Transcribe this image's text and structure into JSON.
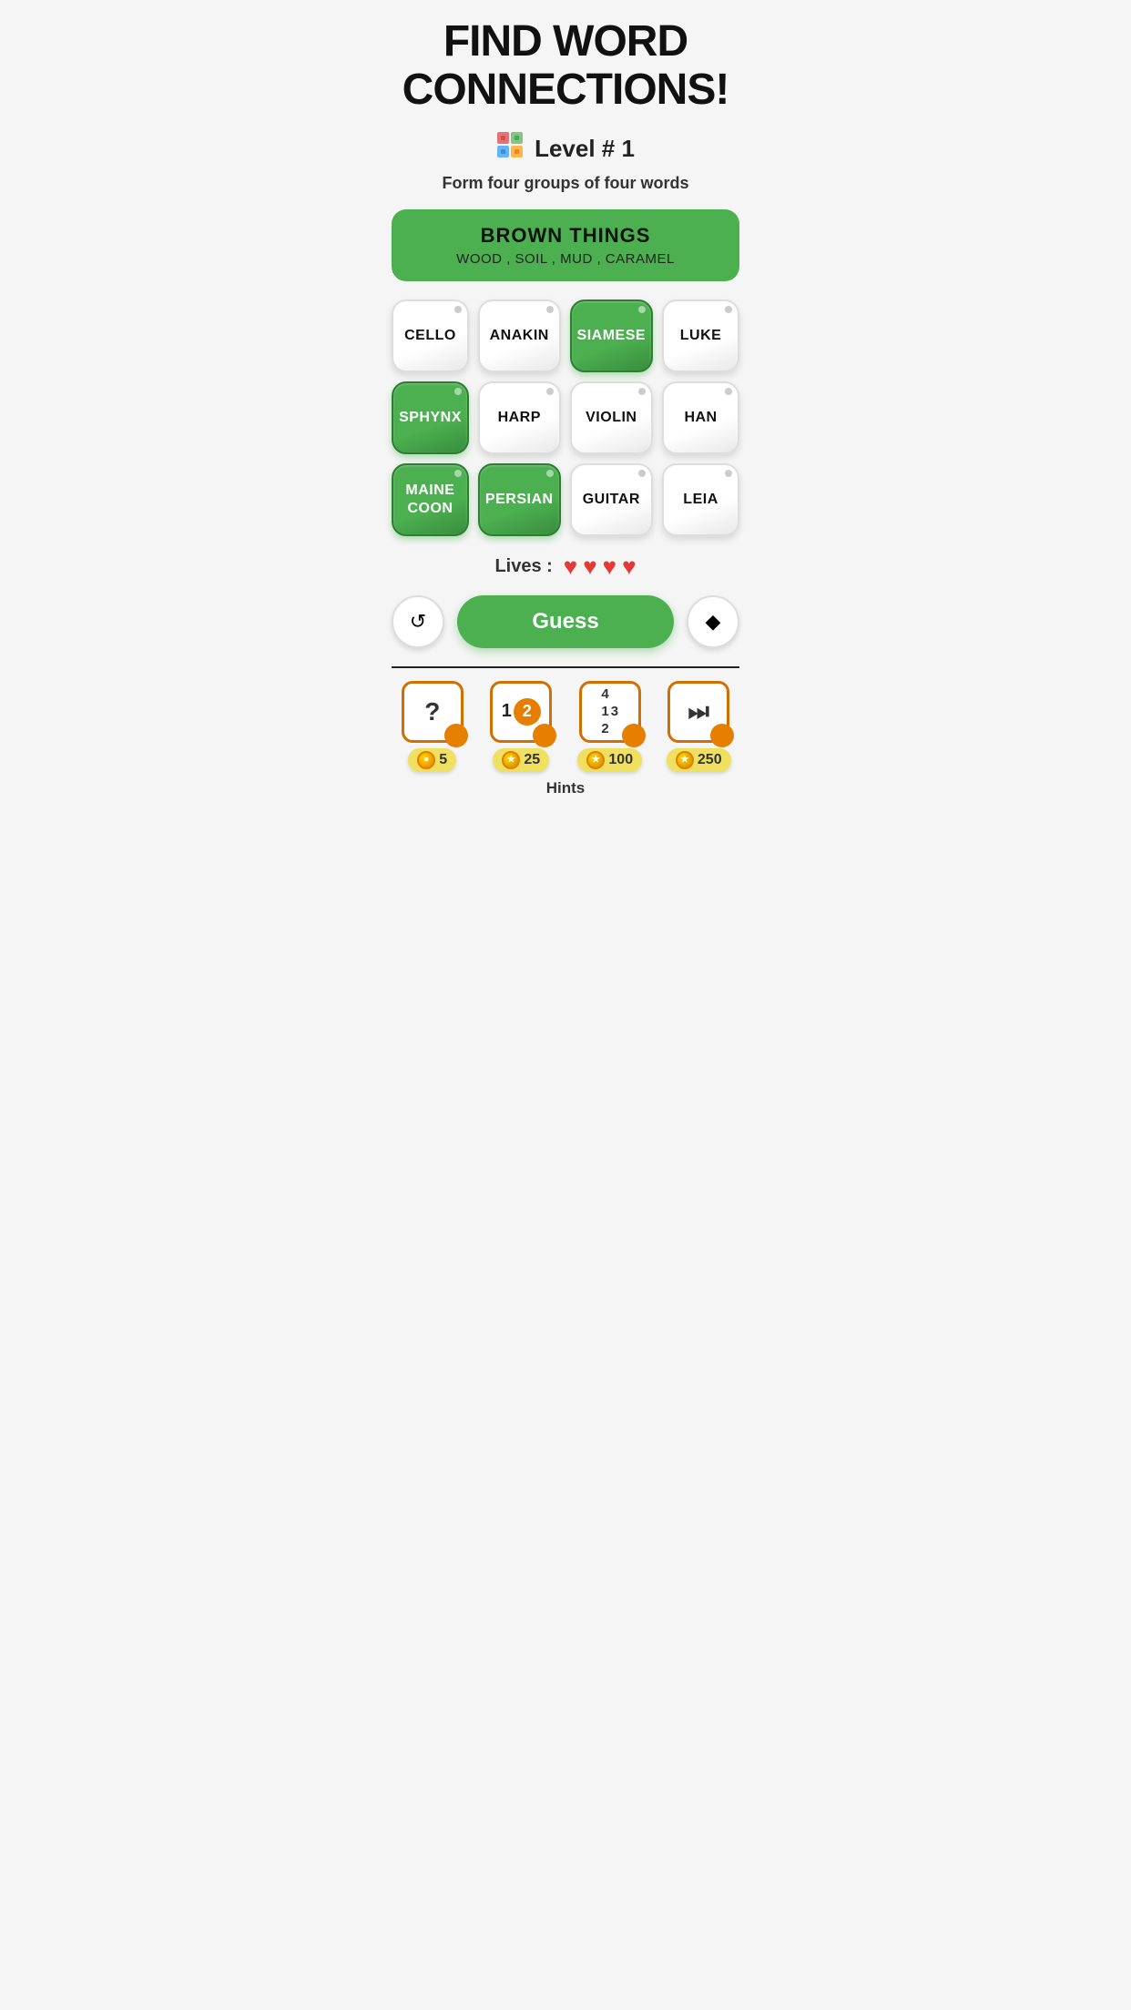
{
  "title": "FIND WORD CONNECTIONS!",
  "level": {
    "icon": "🟪",
    "text": "Level # 1"
  },
  "subtitle": "Form four groups of four words",
  "completed_group": {
    "title": "BROWN THINGS",
    "words": "WOOD , SOIL , MUD , CARAMEL"
  },
  "tiles": [
    {
      "id": 0,
      "label": "CELLO",
      "selected": false
    },
    {
      "id": 1,
      "label": "ANAKIN",
      "selected": false
    },
    {
      "id": 2,
      "label": "SIAMESE",
      "selected": true
    },
    {
      "id": 3,
      "label": "LUKE",
      "selected": false
    },
    {
      "id": 4,
      "label": "SPHYNX",
      "selected": true
    },
    {
      "id": 5,
      "label": "HARP",
      "selected": false
    },
    {
      "id": 6,
      "label": "VIOLIN",
      "selected": false
    },
    {
      "id": 7,
      "label": "HAN",
      "selected": false
    },
    {
      "id": 8,
      "label": "MAINE COON",
      "selected": true
    },
    {
      "id": 9,
      "label": "PERSIAN",
      "selected": true
    },
    {
      "id": 10,
      "label": "GUITAR",
      "selected": false
    },
    {
      "id": 11,
      "label": "LEIA",
      "selected": false
    }
  ],
  "lives": {
    "label": "Lives :",
    "count": 4,
    "heart_char": "♥"
  },
  "buttons": {
    "shuffle_label": "↺",
    "guess_label": "Guess",
    "erase_label": "◆"
  },
  "hints": [
    {
      "id": "hint-question",
      "icon_type": "question",
      "icon_text": "?",
      "cost": "5"
    },
    {
      "id": "hint-12",
      "icon_type": "numbers12",
      "icon_text": "12",
      "cost": "25"
    },
    {
      "id": "hint-123",
      "icon_type": "numbers123",
      "icon_text": "123",
      "cost": "100"
    },
    {
      "id": "hint-play",
      "icon_type": "play",
      "icon_text": "▶|",
      "cost": "250"
    }
  ],
  "hints_label": "Hints",
  "colors": {
    "green": "#4caf50",
    "dark_green": "#388e3c",
    "heart_red": "#e53935",
    "coin_yellow": "#f0e060",
    "orange": "#e67e00"
  }
}
